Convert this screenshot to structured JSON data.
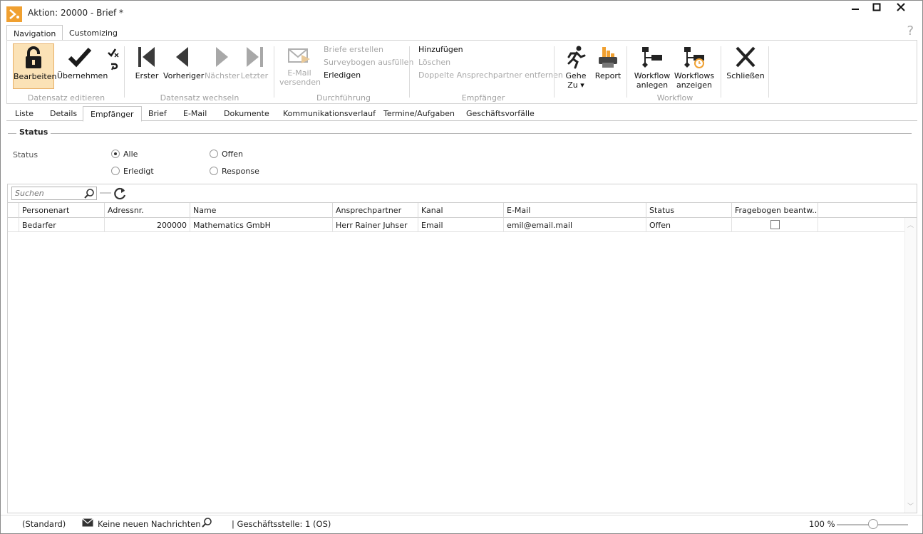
{
  "window": {
    "title": "Aktion: 20000 - Brief *"
  },
  "ribbon_tabs": [
    "Navigation",
    "Customizing"
  ],
  "help": "?",
  "ribbon": {
    "edit": {
      "bearbeiten": "Bearbeiten",
      "uebernehmen": "Übernehmen",
      "group": "Datensatz editieren"
    },
    "switch": {
      "erster": "Erster",
      "vorheriger": "Vorheriger",
      "naechster": "Nächster",
      "letzter": "Letzter",
      "group": "Datensatz wechseln"
    },
    "durchfuehrung": {
      "email_line1": "E-Mail",
      "email_line2": "versenden",
      "briefe": "Briefe erstellen",
      "survey": "Surveybogen ausfüllen",
      "erledigen": "Erledigen",
      "group": "Durchführung"
    },
    "empfaenger": {
      "hinzufuegen": "Hinzufügen",
      "loeschen": "Löschen",
      "doppelte": "Doppelte Ansprechpartner entfernen",
      "group": "Empfänger"
    },
    "misc": {
      "gehe_line1": "Gehe",
      "gehe_line2": "Zu ▾",
      "report": "Report"
    },
    "workflow": {
      "anlegen_line1": "Workflow",
      "anlegen_line2": "anlegen",
      "anzeigen_line1": "Workflows",
      "anzeigen_line2": "anzeigen",
      "group": "Workflow"
    },
    "schliessen": "Schließen"
  },
  "detail_tabs": [
    "Liste",
    "Details",
    "Empfänger",
    "Brief",
    "E-Mail",
    "Dokumente",
    "Kommunikationsverlauf",
    "Termine/Aufgaben",
    "Geschäftsvorfälle"
  ],
  "status_section": {
    "title": "Status",
    "label": "Status",
    "options": {
      "alle": "Alle",
      "offen": "Offen",
      "erledigt": "Erledigt",
      "response": "Response"
    },
    "selected": "Alle"
  },
  "search": {
    "placeholder": "Suchen"
  },
  "grid": {
    "columns": [
      "Personenart",
      "Adressnr.",
      "Name",
      "Ansprechpartner",
      "Kanal",
      "E-Mail",
      "Status",
      "Fragebogen beantw..."
    ],
    "rows": [
      {
        "personenart": "Bedarfer",
        "adressnr": "200000",
        "name": "Mathematics GmbH",
        "ansprechpartner": "Herr Rainer Juhser",
        "kanal": "Email",
        "email": "emil@email.mail",
        "status": "Offen",
        "fragebogen": false
      }
    ]
  },
  "statusbar": {
    "standard": "(Standard)",
    "nachrichten": "Keine neuen Nachrichten",
    "geschaeftsstelle": "| Geschäftsstelle:  1 (OS)",
    "zoom": "100 %",
    "zoom_value_pct": 50
  },
  "colors": {
    "accent": "#f0a030",
    "selected_bg": "#fbe2b6"
  }
}
